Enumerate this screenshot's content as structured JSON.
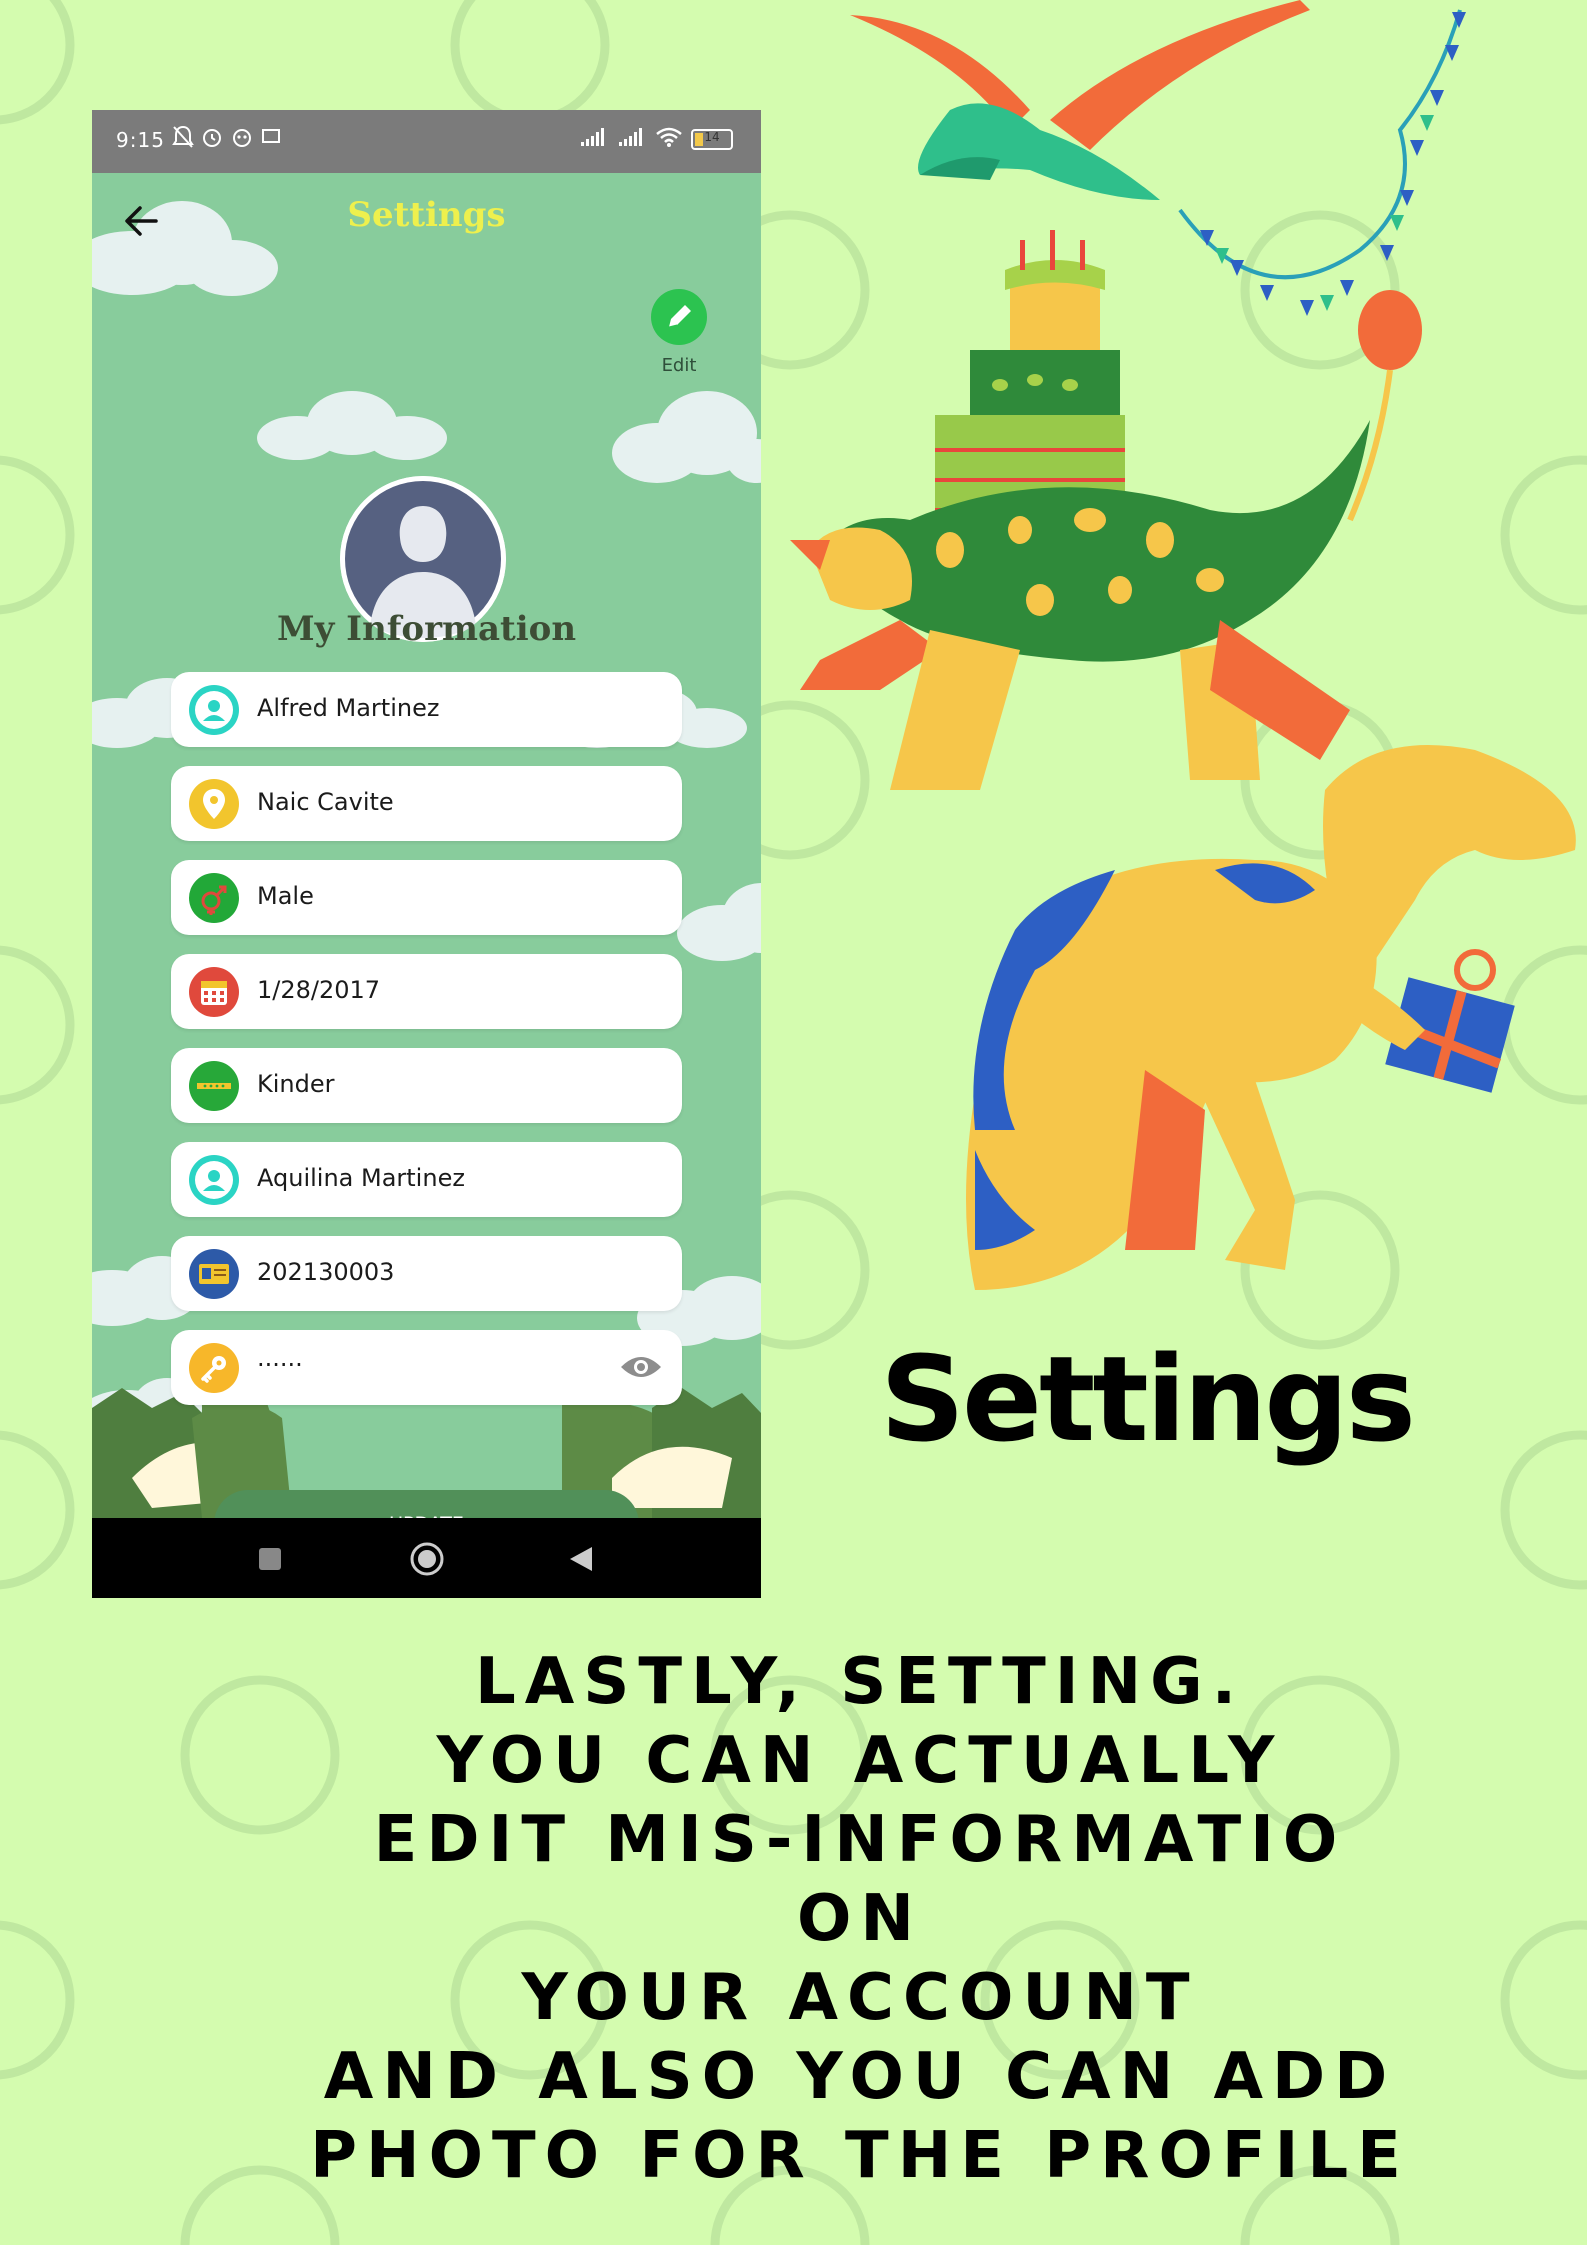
{
  "status_bar": {
    "time": "9:15",
    "battery": "14"
  },
  "app": {
    "title": "Settings",
    "edit_label": "Edit",
    "section_title": "My Information",
    "fields": [
      {
        "value": "Alfred Martinez",
        "icon": "person-icon",
        "icon_color": "#2ad4c4"
      },
      {
        "value": "Naic Cavite",
        "icon": "location-pin-icon",
        "icon_color": "#f2c52d"
      },
      {
        "value": "Male",
        "icon": "gender-icon",
        "icon_color": "#22a838"
      },
      {
        "value": "1/28/2017",
        "icon": "calendar-icon",
        "icon_color": "#e0493c"
      },
      {
        "value": "Kinder",
        "icon": "grade-icon",
        "icon_color": "#27a839"
      },
      {
        "value": "Aquilina Martinez",
        "icon": "person-icon",
        "icon_color": "#2ad4c4"
      },
      {
        "value": "202130003",
        "icon": "id-card-icon",
        "icon_color": "#2d5aa8"
      },
      {
        "value": "......",
        "icon": "key-icon",
        "icon_color": "#f7b72a"
      }
    ],
    "update_label": "UPDATE"
  },
  "headline": "Settings",
  "caption_lines": [
    "LASTLY, SETTING.",
    "YOU CAN ACTUALLY",
    "EDIT MIS-INFORMATIO",
    "ON",
    "YOUR ACCOUNT",
    "AND ALSO YOU CAN ADD",
    "PHOTO FOR THE PROFILE"
  ],
  "colors": {
    "page_background": "#d4fcaf",
    "app_background": "#88cc9c",
    "title_yellow": "#eef04d",
    "button_green": "#519059"
  }
}
